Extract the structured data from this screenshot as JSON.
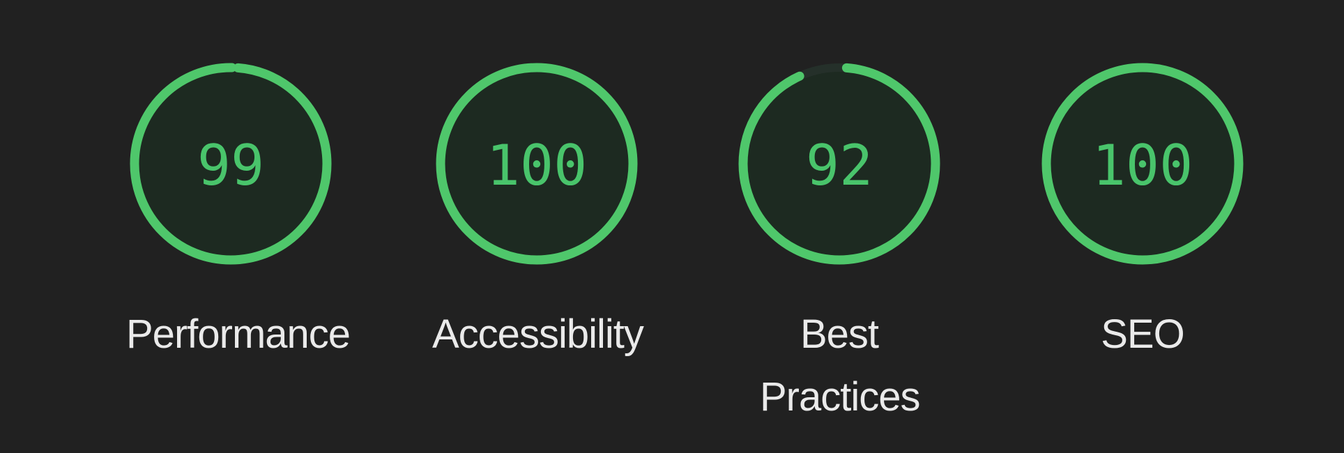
{
  "accent_color": "#4fc76b",
  "scores": [
    {
      "label": "Performance",
      "score": 99
    },
    {
      "label": "Accessibility",
      "score": 100
    },
    {
      "label": "Best Practices",
      "score": 92
    },
    {
      "label": "SEO",
      "score": 100
    }
  ]
}
